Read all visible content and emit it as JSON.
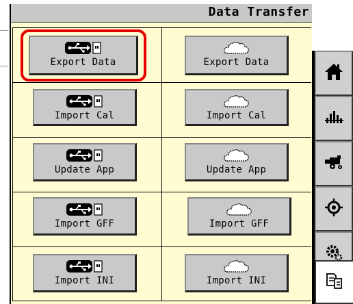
{
  "header": {
    "title": "Data Transfer"
  },
  "buttons": {
    "usb_export": "Export Data",
    "cloud_export": "Export Data",
    "usb_import_cal": "Import Cal",
    "cloud_import_cal": "Import Cal",
    "usb_update_app": "Update App",
    "cloud_update_app": "Update App",
    "usb_import_gff": "Import GFF",
    "cloud_import_gff": "Import GFF",
    "usb_import_ini": "Import INI",
    "cloud_import_ini": "Import INI"
  },
  "sidebar": {
    "items": [
      {
        "icon": "home-icon"
      },
      {
        "icon": "bar-chart-icon"
      },
      {
        "icon": "harvester-icon"
      },
      {
        "icon": "gps-target-icon"
      },
      {
        "icon": "settings-gear-icon"
      },
      {
        "icon": "data-transfer-icon",
        "active": true
      }
    ]
  },
  "colors": {
    "panel_bg": "#fffcd2",
    "button_bg": "#c9c9c9",
    "highlight": "#e50000"
  }
}
